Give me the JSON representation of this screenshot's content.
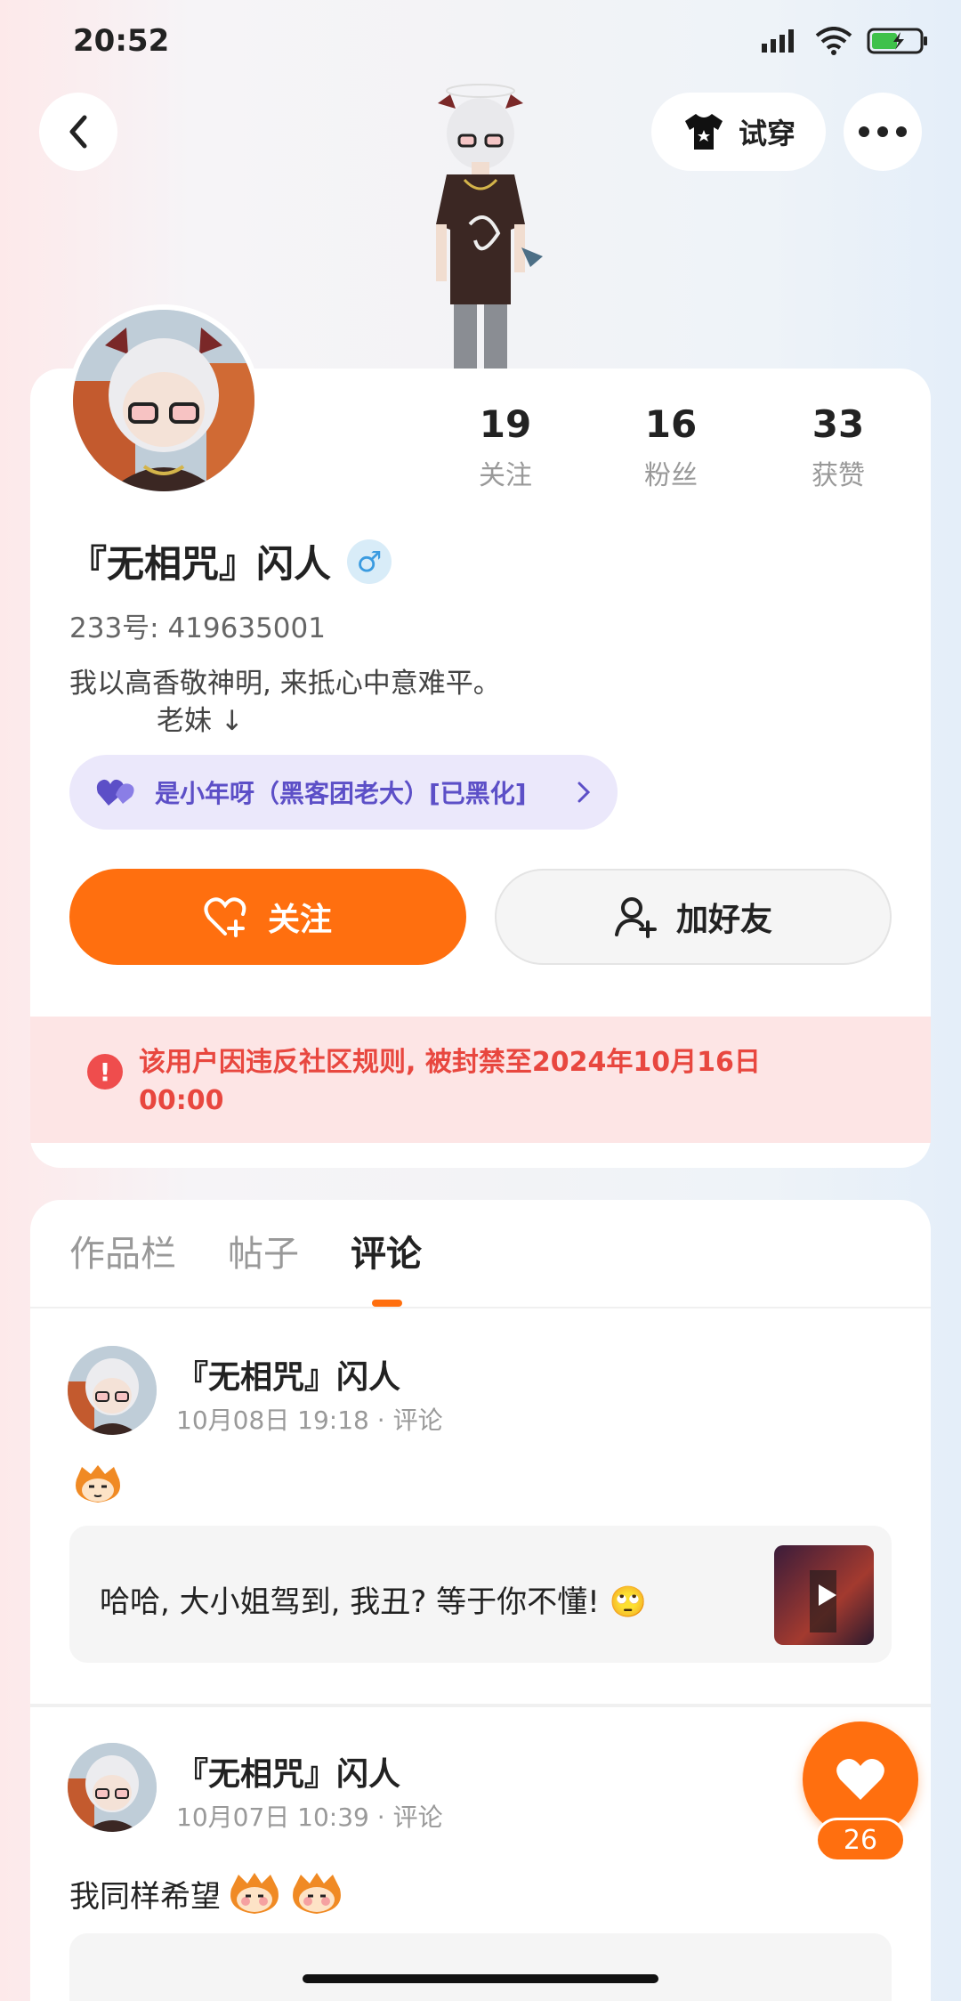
{
  "status_bar": {
    "time": "20:52"
  },
  "header": {
    "try_on_label": "试穿"
  },
  "profile": {
    "stats": [
      {
        "value": "19",
        "label": "关注"
      },
      {
        "value": "16",
        "label": "粉丝"
      },
      {
        "value": "33",
        "label": "获赞"
      }
    ],
    "name": "『无相咒』闪人",
    "gender_symbol": "♂",
    "uid": "233号: 419635001",
    "bio_line1": "我以高香敬神明, 来抵心中意难平。",
    "bio_line2": "老妹 ↓",
    "cp_label": "是小年呀（黑客团老大）[已黑化]"
  },
  "actions": {
    "follow_label": "关注",
    "add_friend_label": "加好友"
  },
  "ban_notice": "该用户因违反社区规则, 被封禁至2024年10月16日 00:00",
  "tabs": [
    "作品栏",
    "帖子",
    "评论"
  ],
  "comments": [
    {
      "author": "『无相咒』闪人",
      "date": "10月08日 19:18",
      "type": "评论",
      "quote": "哈哈, 大小姐驾到, 我丑? 等于你不懂! 🙄"
    },
    {
      "author": "『无相咒』闪人",
      "date": "10月07日 10:39",
      "type": "评论",
      "text": "我同样希望"
    }
  ],
  "like_fab": {
    "count": "26"
  },
  "colors": {
    "accent": "#ff6f0f",
    "ban_text": "#e8473f",
    "ban_bg": "#fde5e5",
    "cp_text": "#5c4fc7"
  }
}
